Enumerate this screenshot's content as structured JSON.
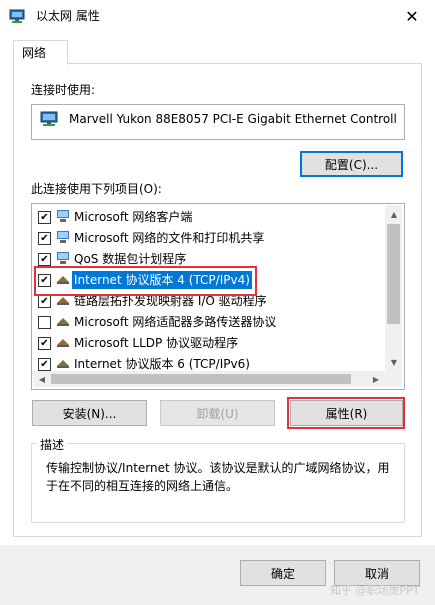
{
  "window": {
    "title": "以太网 属性",
    "close_symbol": "✕"
  },
  "tabs": [
    {
      "label": "网络"
    }
  ],
  "connect_using": {
    "label": "连接时使用:",
    "adapter_name": "Marvell Yukon 88E8057 PCI-E Gigabit Ethernet Controll",
    "configure_label": "配置(C)..."
  },
  "items_section": {
    "label": "此连接使用下列项目(O):"
  },
  "items": [
    {
      "label": "Microsoft 网络客户端",
      "checked": true,
      "icon": "network-client-icon"
    },
    {
      "label": "Microsoft 网络的文件和打印机共享",
      "checked": true,
      "icon": "file-printer-sharing-icon"
    },
    {
      "label": "QoS 数据包计划程序",
      "checked": true,
      "icon": "qos-scheduler-icon"
    },
    {
      "label": "Internet 协议版本 4 (TCP/IPv4)",
      "checked": true,
      "icon": "protocol-icon",
      "selected": true
    },
    {
      "label": "链路层拓扑发现映射器 I/O 驱动程序",
      "checked": true,
      "icon": "protocol-icon"
    },
    {
      "label": "Microsoft 网络适配器多路传送器协议",
      "checked": false,
      "icon": "protocol-icon"
    },
    {
      "label": "Microsoft LLDP 协议驱动程序",
      "checked": true,
      "icon": "protocol-icon"
    },
    {
      "label": "Internet 协议版本 6 (TCP/IPv6)",
      "checked": true,
      "icon": "protocol-icon"
    }
  ],
  "check_symbol": "✔",
  "buttons": {
    "install": "安装(N)...",
    "uninstall": "卸载(U)",
    "properties": "属性(R)",
    "ok": "确定",
    "cancel": "取消"
  },
  "description": {
    "legend": "描述",
    "text": "传输控制协议/Internet 协议。该协议是默认的广域网络协议，用于在不同的相互连接的网络上通信。"
  },
  "scroll_arrows": {
    "up": "▲",
    "down": "▼",
    "left": "◀",
    "right": "▶"
  },
  "watermark": "知乎 @职场虎PPT",
  "colors": {
    "accent": "#0078d7",
    "highlight": "#e0323a",
    "selection": "#0078d7"
  }
}
